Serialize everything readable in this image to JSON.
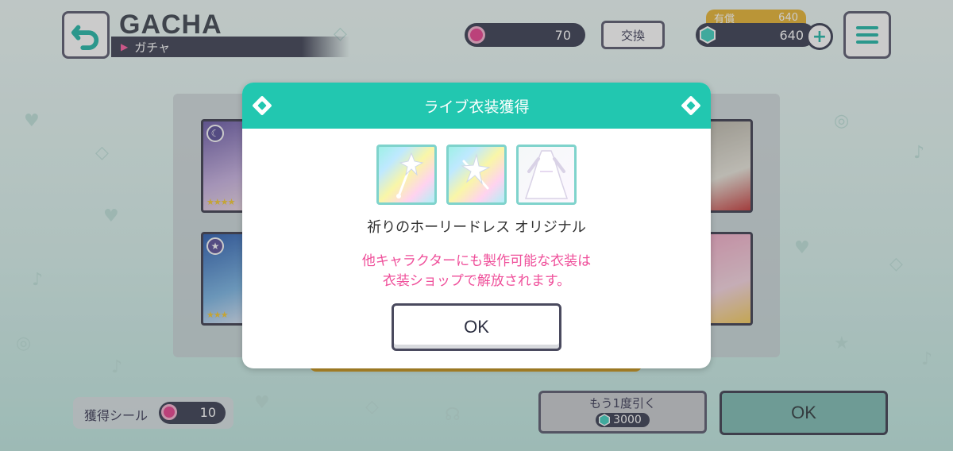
{
  "header": {
    "title": "GACHA",
    "subtitle": "ガチャ",
    "seal_count": "70",
    "exchange_label": "交換",
    "paid_label": "有償",
    "paid_value": "640",
    "gem_count": "640",
    "plus_label": "+"
  },
  "dialog": {
    "title": "ライブ衣装獲得",
    "items": [
      "wand-item-icon",
      "wand-item-icon",
      "dress-item-icon"
    ],
    "item_name": "祈りのホーリードレス オリジナル",
    "note_line1": "他キャラクターにも製作可能な衣装は",
    "note_line2": "衣装ショップで解放されます。",
    "ok_label": "OK"
  },
  "footer": {
    "seal_label": "獲得シール",
    "seal_value": "10",
    "draw_again_label": "もう1度引く",
    "draw_again_cost": "3000",
    "ok_label": "OK"
  },
  "colors": {
    "accent": "#22c7b0",
    "note": "#ef4f9a",
    "gold": "#e8b532",
    "dark": "#3a3d52"
  }
}
